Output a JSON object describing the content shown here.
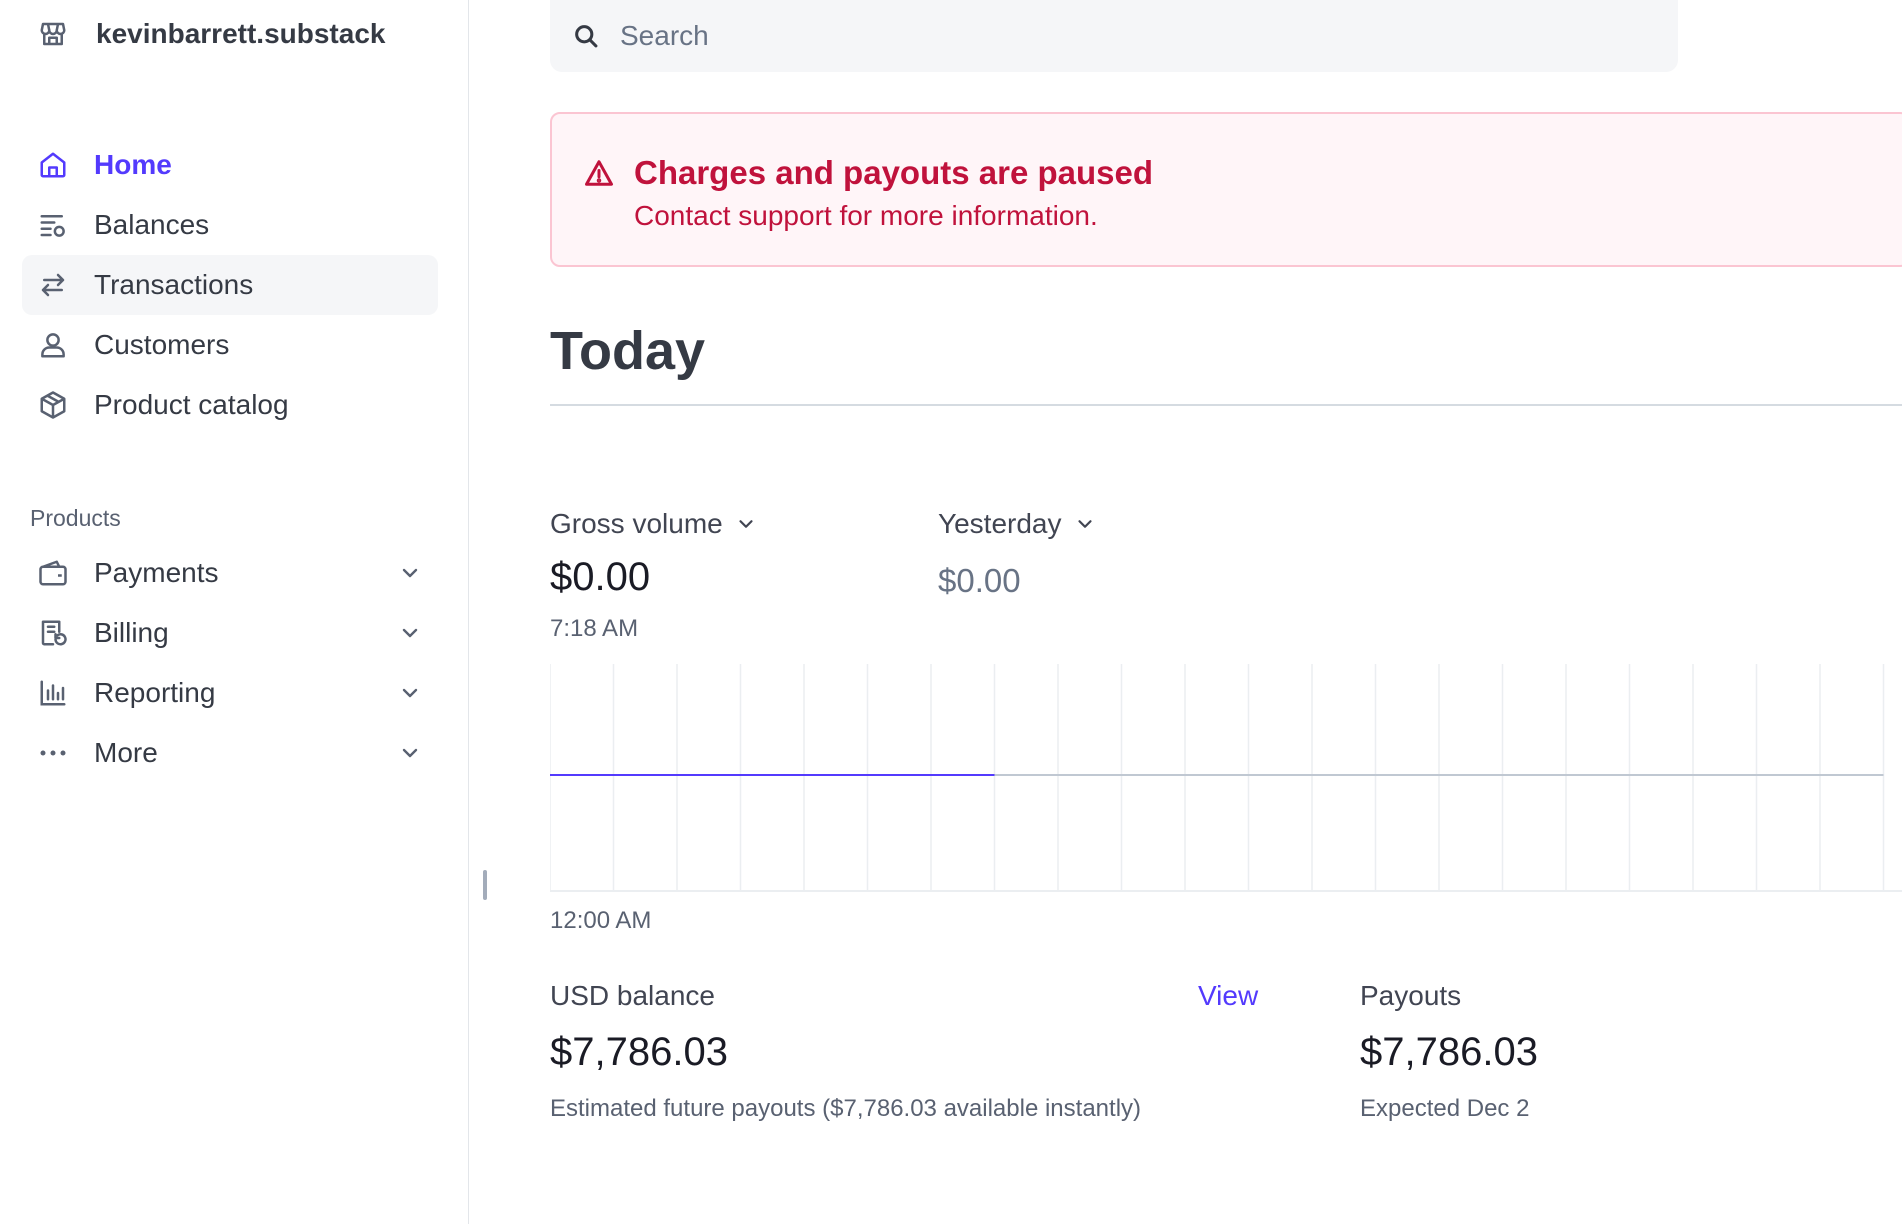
{
  "colors": {
    "accent": "#533afd",
    "text": "#353a44",
    "muted": "#596171",
    "alert_text": "#c0123c",
    "alert_bg": "#fff5f8"
  },
  "account": {
    "name": "kevinbarrett.substack",
    "icon": "storefront-icon"
  },
  "nav": {
    "items": [
      {
        "label": "Home",
        "icon": "home-icon",
        "active": true
      },
      {
        "label": "Balances",
        "icon": "balances-icon"
      },
      {
        "label": "Transactions",
        "icon": "transactions-icon",
        "hover": true
      },
      {
        "label": "Customers",
        "icon": "customer-icon"
      },
      {
        "label": "Product catalog",
        "icon": "box-icon"
      }
    ]
  },
  "products": {
    "title": "Products",
    "items": [
      {
        "label": "Payments",
        "icon": "wallet-icon"
      },
      {
        "label": "Billing",
        "icon": "billing-icon"
      },
      {
        "label": "Reporting",
        "icon": "bar-chart-icon"
      },
      {
        "label": "More",
        "icon": "more-icon"
      }
    ]
  },
  "search": {
    "placeholder": "Search"
  },
  "alert": {
    "title": "Charges and payouts are paused",
    "text": "Contact support for more information."
  },
  "page": {
    "title": "Today"
  },
  "metrics": {
    "primary_label": "Gross volume",
    "primary_value": "$0.00",
    "compare_label": "Yesterday",
    "compare_value": "$0.00",
    "time": "7:18 AM"
  },
  "chart_data": {
    "type": "line",
    "x_start_label": "12:00 AM",
    "series": [
      {
        "values": [
          0,
          0,
          0,
          0,
          0,
          0,
          0,
          0
        ]
      },
      {
        "values": [
          0,
          0,
          0,
          0,
          0,
          0,
          0,
          0,
          0,
          0,
          0,
          0,
          0,
          0,
          0,
          0,
          0,
          0,
          0,
          0,
          0,
          0
        ]
      }
    ],
    "grid": true
  },
  "balance": {
    "label": "USD balance",
    "view": "View",
    "value": "$7,786.03",
    "sub": "Estimated future payouts ($7,786.03 available instantly)"
  },
  "payouts": {
    "label": "Payouts",
    "value": "$7,786.03",
    "sub": "Expected Dec 2"
  }
}
